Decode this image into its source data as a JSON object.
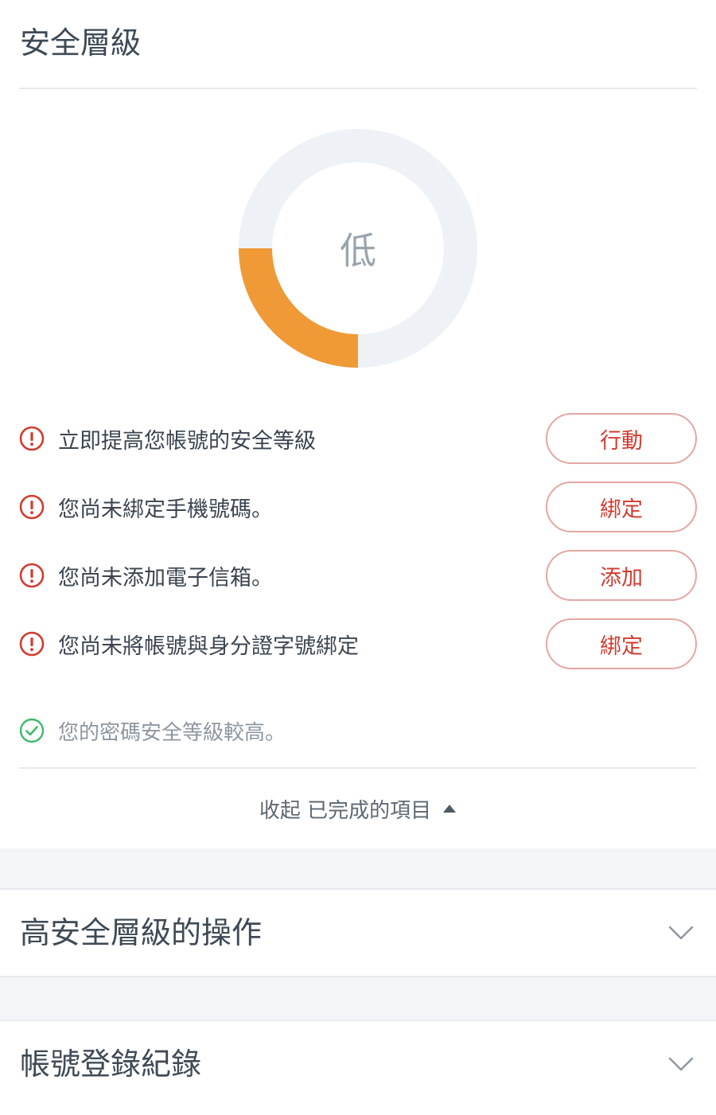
{
  "security": {
    "title": "安全層級",
    "level_label": "低",
    "level_fraction": 0.25,
    "colors": {
      "track": "#eef2f6",
      "fill": "#ef9a36",
      "warn": "#d23b2f",
      "ok": "#3fb96b"
    },
    "items": [
      {
        "icon": "exclamation-circle-icon",
        "text": "立即提高您帳號的安全等級",
        "button": "行動"
      },
      {
        "icon": "exclamation-circle-icon",
        "text": "您尚未綁定手機號碼。",
        "button": "綁定"
      },
      {
        "icon": "exclamation-circle-icon",
        "text": "您尚未添加電子信箱。",
        "button": "添加"
      },
      {
        "icon": "exclamation-circle-icon",
        "text": "您尚未將帳號與身分證字號綁定",
        "button": "綁定"
      }
    ],
    "completed": [
      {
        "icon": "check-circle-icon",
        "text": "您的密碼安全等級較高。"
      }
    ],
    "collapse_label": "收起 已完成的項目"
  },
  "sections": [
    {
      "title": "高安全層級的操作",
      "icon": "chevron-down-icon"
    },
    {
      "title": "帳號登錄紀錄",
      "icon": "chevron-down-icon"
    }
  ]
}
